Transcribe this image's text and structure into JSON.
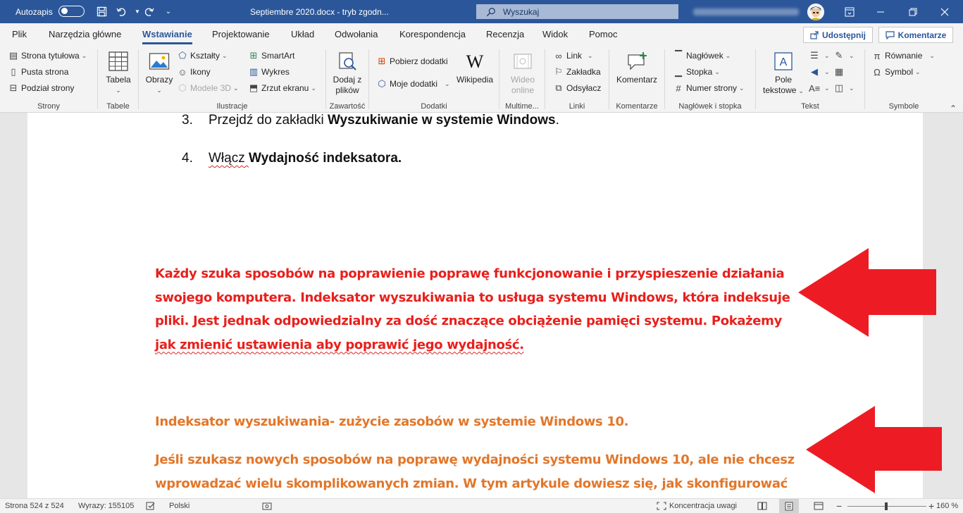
{
  "titlebar": {
    "autosave_label": "Autozapis",
    "document_title": "Septiembre 2020.docx  -  tryb zgodn...",
    "search_placeholder": "Wyszukaj",
    "accent": "#2b579a"
  },
  "tabs": [
    {
      "label": "Plik"
    },
    {
      "label": "Narzędzia główne"
    },
    {
      "label": "Wstawianie",
      "active": true
    },
    {
      "label": "Projektowanie"
    },
    {
      "label": "Układ"
    },
    {
      "label": "Odwołania"
    },
    {
      "label": "Korespondencja"
    },
    {
      "label": "Recenzja"
    },
    {
      "label": "Widok"
    },
    {
      "label": "Pomoc"
    }
  ],
  "share_label": "Udostępnij",
  "comments_label": "Komentarze",
  "ribbon": {
    "strony": {
      "label": "Strony",
      "items": [
        "Strona tytułowa",
        "Pusta strona",
        "Podział strony"
      ]
    },
    "tabele": {
      "label": "Tabele",
      "button": "Tabela"
    },
    "ilustracje": {
      "label": "Ilustracje",
      "obrazy": "Obrazy",
      "ksztalty": "Kształty",
      "ikony": "Ikony",
      "modele3d": "Modele 3D",
      "smartart": "SmartArt",
      "wykres": "Wykres",
      "zrzut": "Zrzut ekranu"
    },
    "zawartosc": {
      "label": "Zawartość",
      "button_line1": "Dodaj z",
      "button_line2": "plików"
    },
    "dodatki": {
      "label": "Dodatki",
      "pobierz": "Pobierz dodatki",
      "moje": "Moje dodatki",
      "wikipedia": "Wikipedia"
    },
    "multimedia": {
      "label": "Multime...",
      "button_line1": "Wideo",
      "button_line2": "online"
    },
    "linki": {
      "label": "Linki",
      "items": [
        "Link",
        "Zakładka",
        "Odsyłacz"
      ]
    },
    "komentarze": {
      "label": "Komentarze",
      "button": "Komentarz"
    },
    "naglowek": {
      "label": "Nagłówek i stopka",
      "items": [
        "Nagłówek",
        "Stopka",
        "Numer strony"
      ]
    },
    "tekst": {
      "label": "Tekst",
      "button_line1": "Pole",
      "button_line2": "tekstowe"
    },
    "symbole": {
      "label": "Symbole",
      "items": [
        "Równanie",
        "Symbol"
      ]
    }
  },
  "document": {
    "list_items": [
      {
        "num": "3.",
        "prefix": "Przejdź do zakładki ",
        "bold": "Wyszukiwanie w systemie Windows",
        "suffix": "."
      },
      {
        "num": "4.",
        "prefix": "Włącz ",
        "bold": "Wydajność indeksatora.",
        "suffix": ""
      }
    ],
    "red_paragraph": [
      "Każdy szuka sposobów na poprawienie poprawę funkcjonowanie i przyspieszenie działania",
      "swojego komputera. Indeksator wyszukiwania to usługa systemu Windows, która indeksuje",
      "pliki. Jest jednak odpowiedzialny za dość znaczące obciążenie pamięci systemu. Pokażemy",
      "jak zmienić ustawienia aby poprawić jego wydajność."
    ],
    "orange_heading": "Indeksator wyszukiwania- zużycie zasobów w systemie Windows 10.",
    "orange_paragraph": [
      "Jeśli szukasz nowych sposobów na poprawę wydajności systemu Windows 10, ale nie chcesz",
      "wprowadzać wielu skomplikowanych zmian. W tym artykule dowiesz się, jak skonfigurować"
    ],
    "red_color": "#e8201c",
    "orange_color": "#e2772a",
    "arrow_color": "#ed1c24"
  },
  "status": {
    "page": "Strona 524 z 524",
    "words": "Wyrazy: 155105",
    "language": "Polski",
    "focus": "Koncentracja uwagi",
    "zoom": "160 %"
  }
}
